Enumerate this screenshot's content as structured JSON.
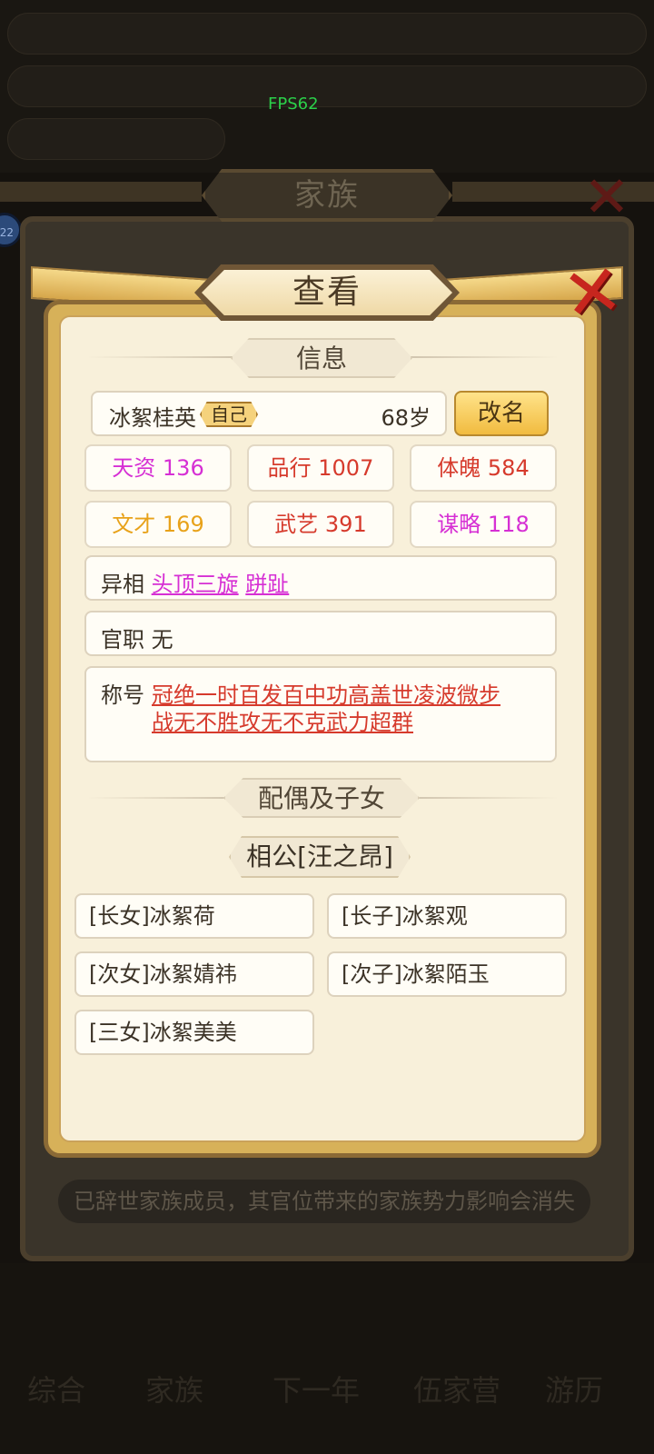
{
  "debug": {
    "fps": "FPS62"
  },
  "background": {
    "rows": [
      "",
      "",
      ""
    ],
    "side_badge": "22",
    "tabs": [
      "综合",
      "家族",
      "下一年",
      "伍家营",
      "游历"
    ]
  },
  "family_panel": {
    "title": "家族",
    "notice": "已辞世家族成员，其官位带来的家族势力影响会消失"
  },
  "dialog": {
    "title": "查看",
    "info_section": "信息",
    "name": "冰絮桂英",
    "self_tag": "自己",
    "age": "68岁",
    "rename_button": "改名",
    "stats": [
      {
        "label": "天资 136",
        "color": "#d62fd4"
      },
      {
        "label": "品行 1007",
        "color": "#d63a2c"
      },
      {
        "label": "体魄 584",
        "color": "#d63a2c"
      },
      {
        "label": "文才 169",
        "color": "#e8a21a"
      },
      {
        "label": "武艺 391",
        "color": "#d63a2c"
      },
      {
        "label": "谋略 118",
        "color": "#d62fd4"
      }
    ],
    "traits": {
      "label": "异相",
      "values": [
        "头顶三旋",
        "跰趾"
      ]
    },
    "office": {
      "label": "官职",
      "value": "无"
    },
    "titles": {
      "label": "称号",
      "line1": "冠绝一时百发百中功高盖世凌波微步",
      "line2": "战无不胜攻无不克武力超群"
    },
    "family_section": "配偶及子女",
    "spouse": "相公[汪之昂]",
    "children": [
      "[长女]冰絮荷",
      "[长子]冰絮观",
      "[次女]冰絮婧祎",
      "[次子]冰絮陌玉",
      "[三女]冰絮美美"
    ]
  }
}
